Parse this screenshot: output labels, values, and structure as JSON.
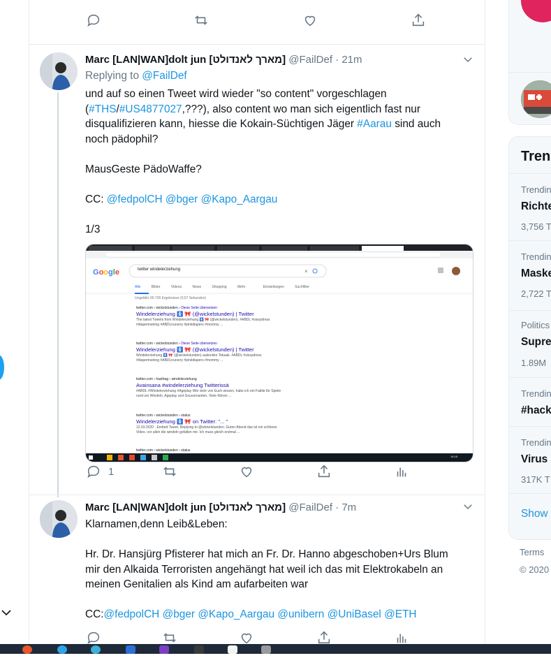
{
  "tweet_actions_top": {
    "reply_count": "",
    "retweet_count": "",
    "like_count": ""
  },
  "tweet1": {
    "name": "Marc [LAN|WAN]dolt jun [מארך לאנדולט]",
    "handle": "@FailDef",
    "dot": "·",
    "time": "21m",
    "replying_label": "Replying to",
    "replying_handle": "@FailDef",
    "line1": "und auf so einen Tweet wird wieder \"so content\" vorgeschlagen",
    "line2_a": "(",
    "line2_h1": "#THS",
    "line2_b": "/",
    "line2_h2": "#US4877027",
    "line2_c": ",???), also content wo man sich eigentlich fast nur",
    "line3_a": "disqualifizieren kann, hiesse die Kokain-Süchtigen Jäger ",
    "line3_h": "#Aarau",
    "line3_b": " sind auch",
    "line4": "noch pädophil?",
    "line5": "MausGeste PädoWaffe?",
    "cc_label": "CC: ",
    "cc1": "@fedpolCH",
    "cc2": "@bger",
    "cc3": "@Kapo_Aargau",
    "page": "1/3",
    "reply_count": "1"
  },
  "screenshot": {
    "search_query": "twitter windelerziehung",
    "tabs": [
      "Alle",
      "Bilder",
      "Videos",
      "News",
      "Shopping",
      "Mehr",
      "Einstellungen",
      "Suchfilter"
    ],
    "results_count": "Ungefähr 90.700 Ergebnisse (0,57 Sekunden)",
    "results": [
      {
        "url": "twitter.com › wickelstunden",
        "translate": "Diese Seite übersetzen",
        "title": "Windelerziehung 🚼 🎀 (@wickelstunden) | Twitter",
        "s1": "The latest Tweets from Windelerziehung 🚼 🎀 (@wickelstunden). #ABDL #sissydress",
        "s2": "#diapertraining #ABDLnursery #pinkdiapers #mommy ..."
      },
      {
        "url": "twitter.com › wickelstunden",
        "translate": "Diese Seite übersetzen",
        "title": "Windelerziehung 🚼 🎀 (@wickelstunden) | Twitter",
        "s1": "Windelerziehung 🚼 🎀 (@wickelstunden) aukerisko Tekaak. #ABDL #sissydress",
        "s2": "#diapertraining #ABDLnursery #pinkdiapers #mommy ..."
      },
      {
        "url": "twitter.com › hashtag › windelerziehung",
        "translate": "",
        "title": "Avainsana #windelerziehung Twitterissä",
        "s1": "#ABDL #Windelerziehung #Ageplay Wie viele von Euch wissen, habe ich ein Faible für Spiele",
        "s2": "rund um Windeln, Ageplay und Gouvernanten. Viele führen ..."
      },
      {
        "url": "twitter.com › wickelstunden › status",
        "translate": "",
        "title": "Windelerziehung 🚼 🎀 on Twitter: \"... \"",
        "s1": "12.03.2020 · Embed Tweet. Replying to @wickelstunden. Guten Abend das ist ein schönes",
        "s2": "Video. vor allen die windeln gefallen mir. Ich muss gleich erstmal ..."
      },
      {
        "url": "twitter.com › wickelstunden › status",
        "translate": "",
        "title": "",
        "s1": "",
        "s2": ""
      }
    ],
    "clock": "14:15"
  },
  "tweet2": {
    "name": "Marc [LAN|WAN]dolt jun [מארך לאנדולט]",
    "handle": "@FailDef",
    "dot": "·",
    "time": "7m",
    "line1": "Klarnamen,denn Leib&Leben:",
    "line2": "Hr. Dr. Hansjürg Pfisterer hat mich an Fr. Dr. Hanno abgeschoben+Urs Blum",
    "line3": "mir den Alkaida Terroristen angehängt hat weil ich das mit Elektrokabeln an",
    "line4": "meinen Genitalien als Kind am aufarbeiten war",
    "cc_label": "CC:",
    "cc1": "@fedpolCH",
    "cc2": "@bger",
    "cc3": "@Kapo_Aargau",
    "cc4": "@unibern",
    "cc5": "@UniBasel",
    "cc6": "@ETH"
  },
  "trends": {
    "title": "Tren",
    "items": [
      {
        "category": "Trendin",
        "name": "Richte",
        "count": "3,756 T"
      },
      {
        "category": "Trendin",
        "name": "Maske",
        "count": "2,722 T"
      },
      {
        "category": "Politics",
        "name": "Supre",
        "count": "1.89M"
      },
      {
        "category": "Trendin",
        "name": "#hack",
        "count": ""
      },
      {
        "category": "Trendin",
        "name": "Virus",
        "count": "317K T"
      }
    ],
    "show_more": "Show"
  },
  "footer": {
    "terms": "Terms",
    "copyright": "© 2020"
  },
  "colors": {
    "link": "#1b95e0",
    "secondary": "#657786",
    "border": "#e6ecf0",
    "accent": "#1da1f2"
  }
}
